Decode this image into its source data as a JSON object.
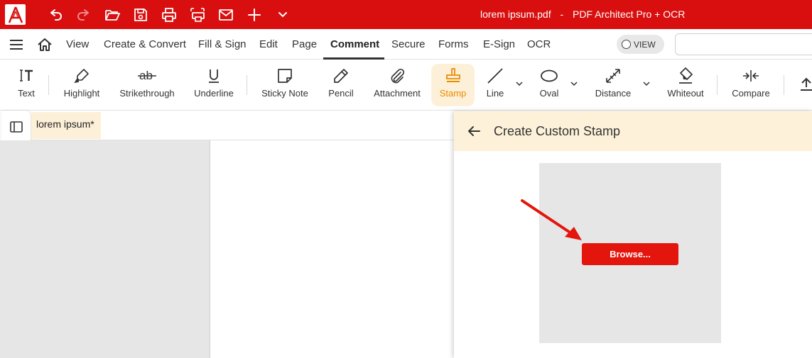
{
  "app": {
    "logo_icon": "pdf-architect-logo",
    "file_name": "lorem ipsum.pdf",
    "separator": "-",
    "product_name": "PDF Architect Pro + OCR",
    "brand_color": "#d90f0f"
  },
  "quick_access": [
    "undo-icon",
    "redo-icon",
    "open-folder-icon",
    "save-icon",
    "print-icon",
    "scan-icon",
    "mail-icon",
    "plus-icon",
    "chevron-down-icon"
  ],
  "menu": {
    "items": [
      {
        "label": "View"
      },
      {
        "label": "Create & Convert"
      },
      {
        "label": "Fill & Sign"
      },
      {
        "label": "Edit"
      },
      {
        "label": "Page"
      },
      {
        "label": "Comment",
        "active": true
      },
      {
        "label": "Secure"
      },
      {
        "label": "Forms"
      },
      {
        "label": "E-Sign"
      },
      {
        "label": "OCR"
      }
    ],
    "view_toggle": "VIEW"
  },
  "ribbon": {
    "tools": [
      {
        "label": "Text",
        "icon": "text-icon"
      },
      {
        "label": "Highlight",
        "icon": "highlight-icon"
      },
      {
        "label": "Strikethrough",
        "icon": "strikethrough-icon"
      },
      {
        "label": "Underline",
        "icon": "underline-icon"
      },
      {
        "label": "Sticky Note",
        "icon": "sticky-note-icon"
      },
      {
        "label": "Pencil",
        "icon": "pencil-icon"
      },
      {
        "label": "Attachment",
        "icon": "attachment-icon"
      },
      {
        "label": "Stamp",
        "icon": "stamp-icon",
        "active": true
      },
      {
        "label": "Line",
        "icon": "line-icon"
      },
      {
        "label": "Oval",
        "icon": "oval-icon"
      },
      {
        "label": "Distance",
        "icon": "distance-icon"
      },
      {
        "label": "Whiteout",
        "icon": "whiteout-icon"
      },
      {
        "label": "Compare",
        "icon": "compare-icon"
      }
    ],
    "active_color": "#e98c00"
  },
  "document": {
    "tab_label": "lorem ipsum*"
  },
  "panel": {
    "title": "Create Custom Stamp",
    "browse_label": "Browse...",
    "button_color": "#e3150d"
  }
}
